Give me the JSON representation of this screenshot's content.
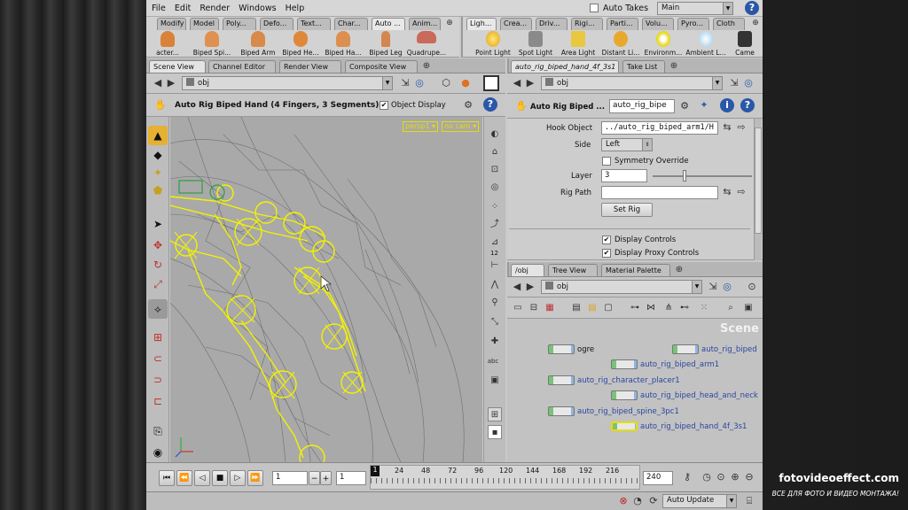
{
  "menubar": {
    "items": [
      "File",
      "Edit",
      "Render",
      "Windows",
      "Help"
    ],
    "auto_takes": "Auto Takes",
    "desktop": "Main"
  },
  "shelf_left": {
    "tabs": [
      "Modify",
      "Model",
      "Poly...",
      "Defo...",
      "Text...",
      "Char...",
      "Auto ...",
      "Anim..."
    ],
    "active_tab": 6,
    "tools": [
      "acter...",
      "Biped Spi...",
      "Biped Arm",
      "Biped He...",
      "Biped Ha...",
      "Biped Leg",
      "Quadrupe..."
    ]
  },
  "shelf_right": {
    "tabs": [
      "Ligh...",
      "Crea...",
      "Driv...",
      "Rigi...",
      "Parti...",
      "Volu...",
      "Pyro...",
      "Cloth"
    ],
    "active_tab": 0,
    "tools": [
      "Point Light",
      "Spot Light",
      "Area Light",
      "Distant Li...",
      "Environm...",
      "Ambient L...",
      "Came"
    ]
  },
  "viewer": {
    "tabs": [
      "Scene View",
      "Channel Editor",
      "Render View",
      "Composite View"
    ],
    "path": "obj",
    "title": "Auto Rig Biped Hand (4 Fingers, 3 Segments)",
    "object_display": "Object Display",
    "persp": "persp1",
    "cam": "no cam",
    "ruler_label": "12"
  },
  "params": {
    "tabs": [
      "auto_rig_biped_hand_4f_3s1",
      "Take List"
    ],
    "path": "obj",
    "title": "Auto Rig Biped ...",
    "name_value": "auto_rig_bipe",
    "hook_object_label": "Hook Object",
    "hook_object_value": "../auto_rig_biped_arm1/H",
    "side_label": "Side",
    "side_value": "Left",
    "symmetry_label": "Symmetry Override",
    "layer_label": "Layer",
    "layer_value": "3",
    "layer_fraction": 0.3,
    "rig_path_label": "Rig Path",
    "set_rig": "Set Rig",
    "display_controls": "Display Controls",
    "display_proxy": "Display Proxy Controls"
  },
  "network": {
    "tabs": [
      "/obj",
      "Tree View",
      "Material Palette"
    ],
    "path": "obj",
    "scene_label": "Scene",
    "nodes": [
      {
        "label": "ogre",
        "selected": false
      },
      {
        "label": "auto_rig_biped",
        "selected": false
      },
      {
        "label": "auto_rig_biped_arm1",
        "selected": false
      },
      {
        "label": "auto_rig_character_placer1",
        "selected": false
      },
      {
        "label": "auto_rig_biped_head_and_neck",
        "selected": false
      },
      {
        "label": "auto_rig_biped_spine_3pc1",
        "selected": false
      },
      {
        "label": "auto_rig_biped_hand_4f_3s1",
        "selected": true
      }
    ]
  },
  "timeline": {
    "current_frame": "1",
    "start_frame": "1",
    "end_frame": "240",
    "marker_frame": "1",
    "ticks": [
      "24",
      "48",
      "72",
      "96",
      "120",
      "144",
      "168",
      "192",
      "216"
    ],
    "auto_update": "Auto Update"
  },
  "watermark": {
    "site": "fotovideoeffect.com",
    "slogan": "ВСЕ ДЛЯ ФОТО И ВИДЕО МОНТАЖА!"
  },
  "colors": {
    "rig": "#f2f200",
    "wire": "#6e6e6e",
    "viewport_bg": "#a9a9a9",
    "help": "#2a57a8"
  }
}
